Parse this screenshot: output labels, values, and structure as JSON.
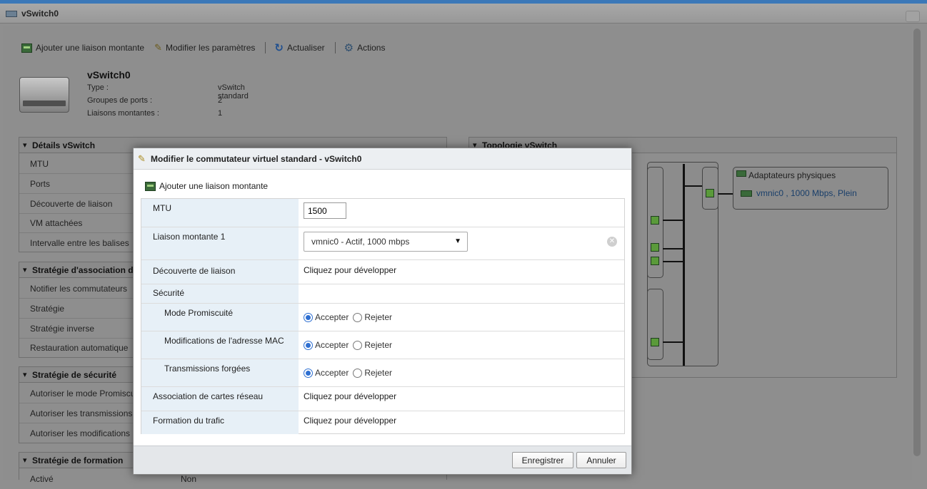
{
  "window": {
    "title": "vSwitch0"
  },
  "toolbar": {
    "add_uplink": "Ajouter une liaison montante",
    "edit_settings": "Modifier les paramètres",
    "refresh": "Actualiser",
    "actions": "Actions"
  },
  "summary": {
    "name": "vSwitch0",
    "rows": [
      {
        "label": "Type :",
        "value": "vSwitch standard"
      },
      {
        "label": "Groupes de ports :",
        "value": "2"
      },
      {
        "label": "Liaisons montantes :",
        "value": "1"
      }
    ]
  },
  "details": {
    "title": "Détails vSwitch",
    "rows": [
      "MTU",
      "Ports",
      "Découverte de liaison",
      "VM attachées",
      "Intervalle entre les balises"
    ]
  },
  "nic_teaming": {
    "title": "Stratégie d'association d",
    "rows": [
      "Notifier les commutateurs",
      "Stratégie",
      "Stratégie inverse",
      "Restauration automatique"
    ]
  },
  "security_policy": {
    "title": "Stratégie de sécurité",
    "rows": [
      "Autoriser le mode Promiscu",
      "Autoriser les transmissions",
      "Autoriser les modifications"
    ]
  },
  "shaping_policy": {
    "title": "Stratégie de formation",
    "row_label": "Activé",
    "row_value": "Non"
  },
  "topology": {
    "title": "Topologie vSwitch",
    "physical_adapters": "Adaptateurs physiques",
    "vmnic": "vmnic0 , 1000 Mbps, Plein"
  },
  "dialog": {
    "title": "Modifier le commutateur virtuel standard - vSwitch0",
    "add_uplink": "Ajouter une liaison montante",
    "mtu_label": "MTU",
    "mtu_value": "1500",
    "uplink_label": "Liaison montante 1",
    "uplink_value": "vmnic0 - Actif, 1000 mbps",
    "link_discovery_label": "Découverte de liaison",
    "click_expand": "Cliquez pour développer",
    "security_label": "Sécurité",
    "promiscuous_label": "Mode Promiscuité",
    "mac_changes_label": "Modifications de l'adresse MAC",
    "forged_label": "Transmissions forgées",
    "accept": "Accepter",
    "reject": "Rejeter",
    "nic_teaming_label": "Association de cartes réseau",
    "traffic_shaping_label": "Formation du trafic",
    "save": "Enregistrer",
    "cancel": "Annuler"
  }
}
